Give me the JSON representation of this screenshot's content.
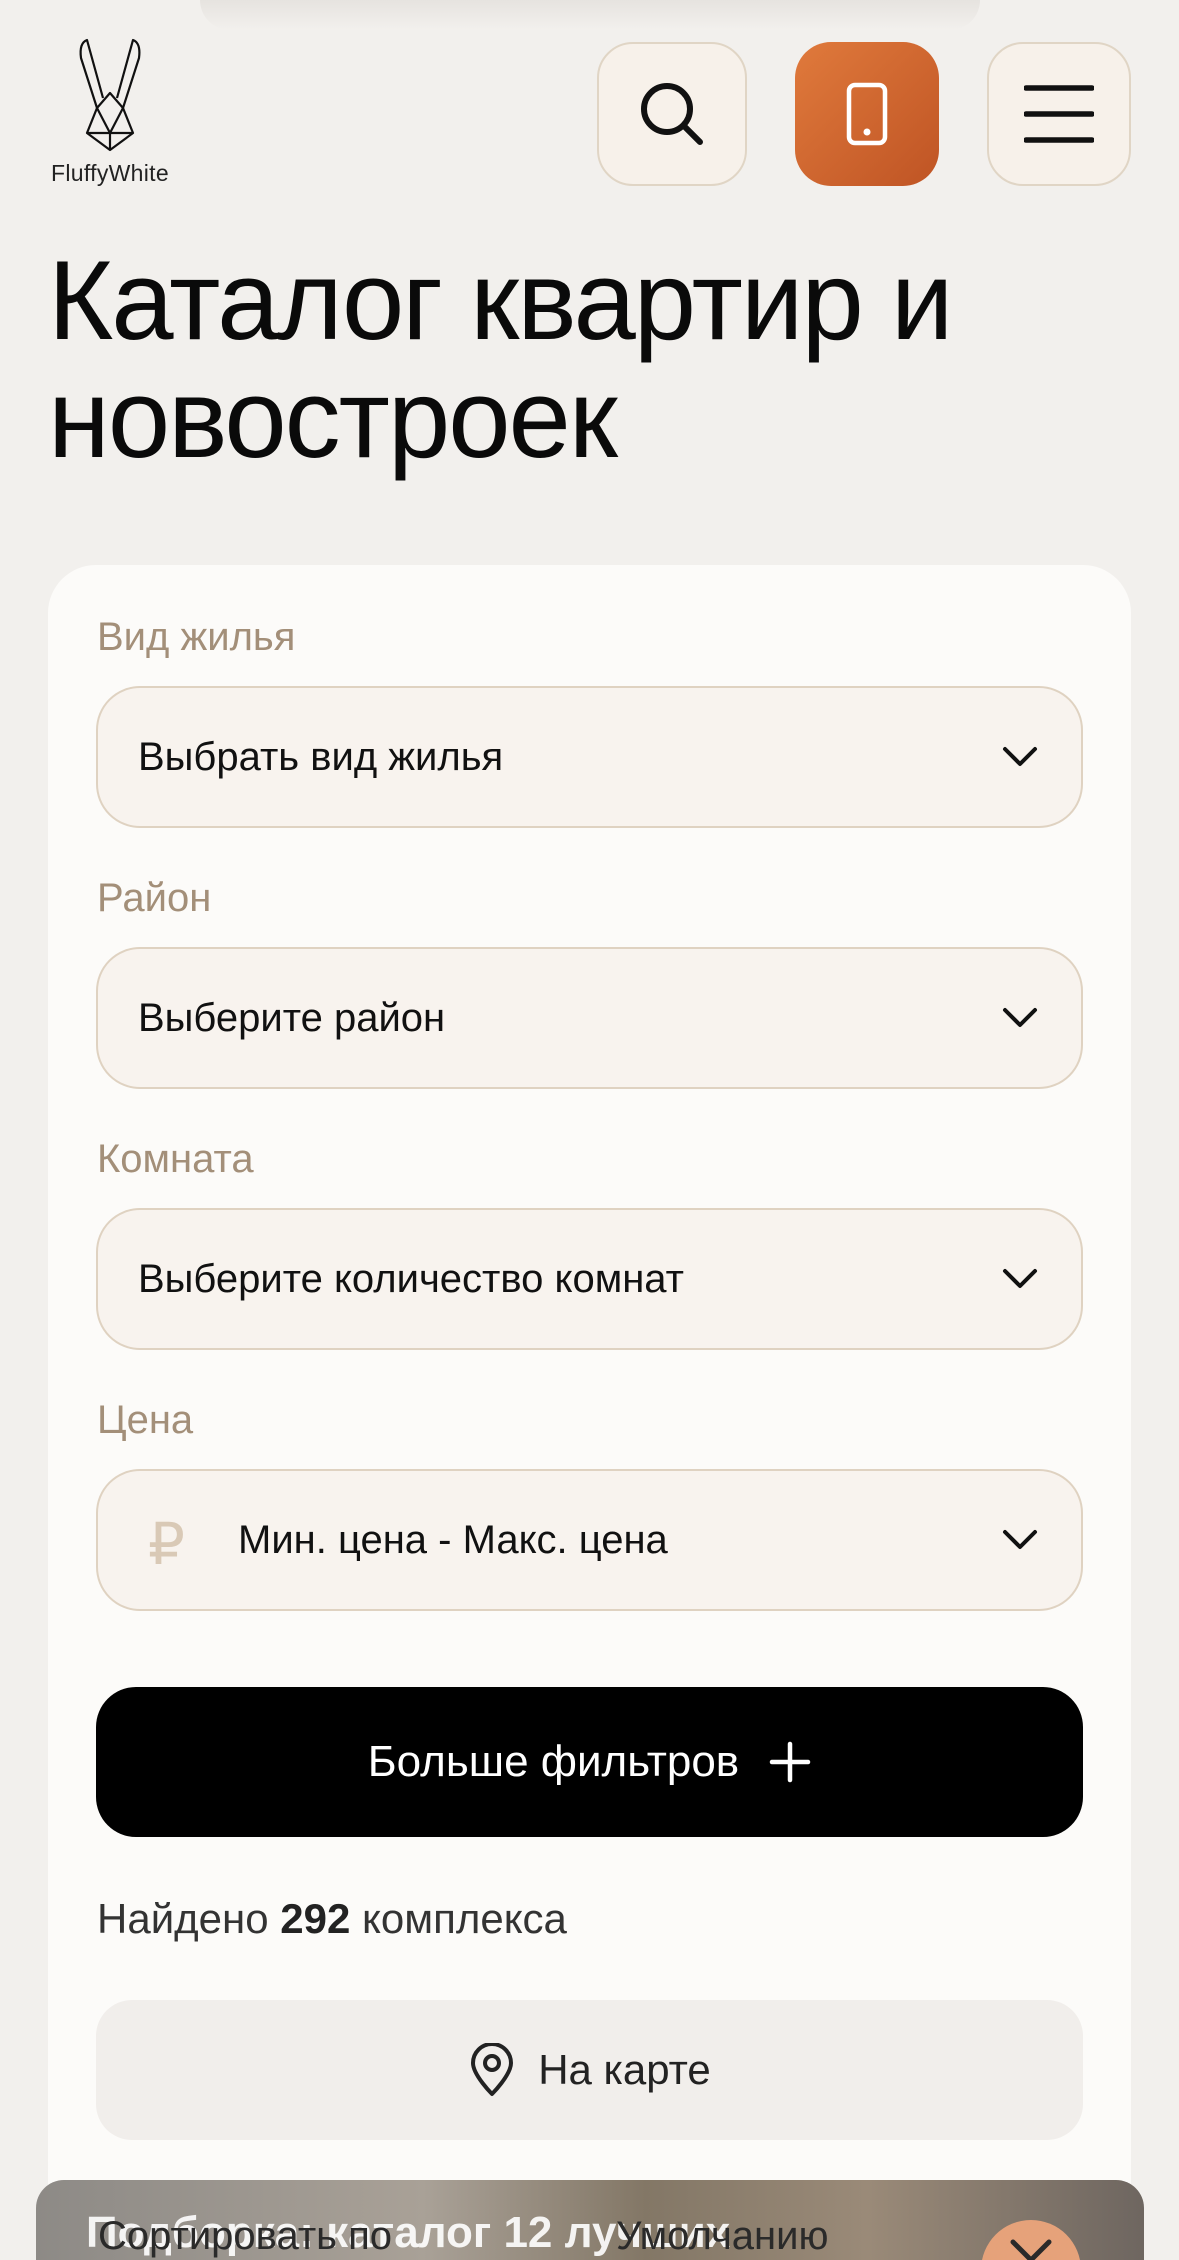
{
  "header": {
    "logo_text": "FluffyWhite",
    "search_icon": "search-icon",
    "phone_icon": "phone-icon",
    "menu_icon": "hamburger-menu-icon",
    "accent": "#d2662f"
  },
  "page": {
    "title": "Каталог квартир и новостроек"
  },
  "filters": {
    "housing_type": {
      "label": "Вид жилья",
      "value": "Выбрать вид жилья"
    },
    "district": {
      "label": "Район",
      "value": "Выберите район"
    },
    "rooms": {
      "label": "Комната",
      "value": "Выберите количество комнат"
    },
    "price": {
      "label": "Цена",
      "currency_symbol": "₽",
      "value": "Мин. цена - Макс. цена"
    },
    "more_button": "Больше фильтров",
    "more_icon": "plus-icon"
  },
  "results": {
    "prefix": "Найдено",
    "count": "292",
    "suffix": "комплекса"
  },
  "map_button": {
    "label": "На карте",
    "icon": "map-pin-icon"
  },
  "bottom_bar": {
    "background_text": "Подборка: каталог 12 лучших",
    "sort_label": "Сортировать по",
    "sort_value": "Умолчанию"
  }
}
